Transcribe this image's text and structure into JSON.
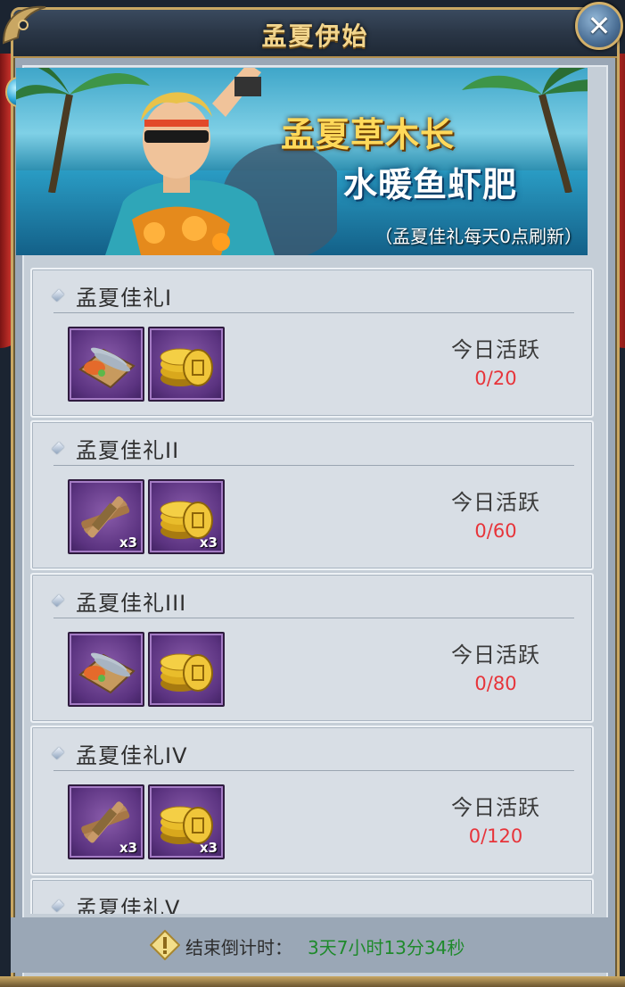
{
  "window": {
    "title": "孟夏伊始",
    "close_icon": "close-icon"
  },
  "banner": {
    "title_line1": "孟夏草木长",
    "title_line2": "水暖鱼虾肥",
    "note": "（孟夏佳礼每天0点刷新）"
  },
  "gifts": [
    {
      "title": "孟夏佳礼I",
      "items": [
        {
          "icon": "fish-platter-icon",
          "qty": ""
        },
        {
          "icon": "gold-coins-icon",
          "qty": ""
        }
      ],
      "activity_label": "今日活跃",
      "activity_value": "0/20"
    },
    {
      "title": "孟夏佳礼II",
      "items": [
        {
          "icon": "wood-bundle-icon",
          "qty": "x3"
        },
        {
          "icon": "gold-coins-icon",
          "qty": "x3"
        }
      ],
      "activity_label": "今日活跃",
      "activity_value": "0/60"
    },
    {
      "title": "孟夏佳礼III",
      "items": [
        {
          "icon": "fish-platter-icon",
          "qty": ""
        },
        {
          "icon": "gold-coins-icon",
          "qty": ""
        }
      ],
      "activity_label": "今日活跃",
      "activity_value": "0/80"
    },
    {
      "title": "孟夏佳礼IV",
      "items": [
        {
          "icon": "wood-bundle-icon",
          "qty": "x3"
        },
        {
          "icon": "gold-coins-icon",
          "qty": "x3"
        }
      ],
      "activity_label": "今日活跃",
      "activity_value": "0/120"
    },
    {
      "title": "孟夏佳礼V"
    }
  ],
  "footer": {
    "label": "结束倒计时：",
    "countdown": "3天7小时13分34秒",
    "icon": "warning-diamond-icon"
  },
  "colors": {
    "accent_gold": "#c9a763",
    "activity_red": "#e7343a",
    "countdown_green": "#1f8a2c",
    "item_purple": "#5b3380"
  }
}
